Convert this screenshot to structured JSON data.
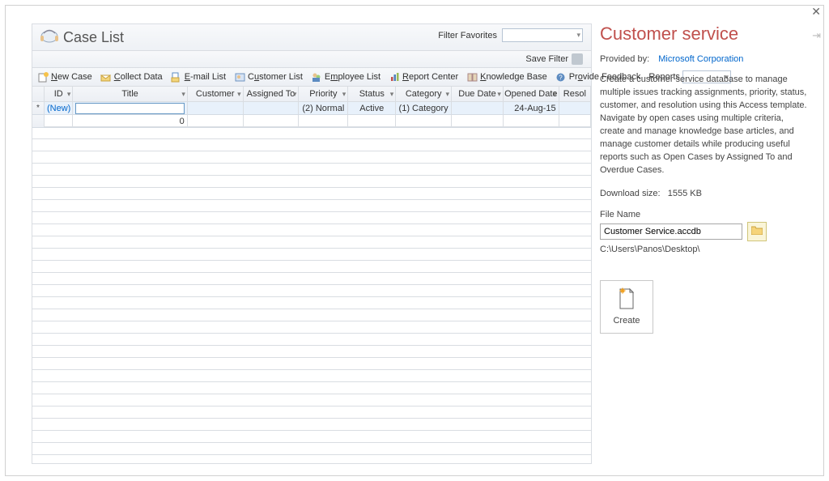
{
  "case_list": {
    "title": "Case List",
    "filter_favorites_label": "Filter Favorites",
    "save_filter_label": "Save Filter",
    "toolbar": {
      "new_case": "New Case",
      "collect_data": "Collect Data",
      "email_list": "E-mail List",
      "customer_list": "Customer List",
      "employee_list": "Employee List",
      "report_center": "Report Center",
      "knowledge_base": "Knowledge Base",
      "provide_feedback": "Provide Feedback",
      "reports": "Reports"
    },
    "columns": {
      "id": "ID",
      "title": "Title",
      "customer": "Customer",
      "assigned_to": "Assigned To",
      "priority": "Priority",
      "status": "Status",
      "category": "Category",
      "due_date": "Due Date",
      "opened_date": "Opened Date",
      "resolved": "Resol"
    },
    "row1": {
      "id": "(New)",
      "priority": "(2) Normal",
      "status": "Active",
      "category": "(1) Category",
      "opened_date": "24-Aug-15"
    },
    "row2": {
      "title": "0"
    }
  },
  "side": {
    "title": "Customer service",
    "provided_by_label": "Provided by:",
    "provided_by_link": "Microsoft Corporation",
    "description": "Create a customer service database to manage multiple issues tracking assignments, priority, status, customer, and resolution using this Access template. Navigate by open cases using multiple criteria, create and manage knowledge base articles, and manage customer details while producing useful reports such as Open Cases by Assigned To and Overdue Cases.",
    "download_label": "Download size:",
    "download_value": "1555 KB",
    "file_name_label": "File Name",
    "file_name_value": "Customer Service.accdb",
    "path": "C:\\Users\\Panos\\Desktop\\",
    "create_label": "Create"
  }
}
